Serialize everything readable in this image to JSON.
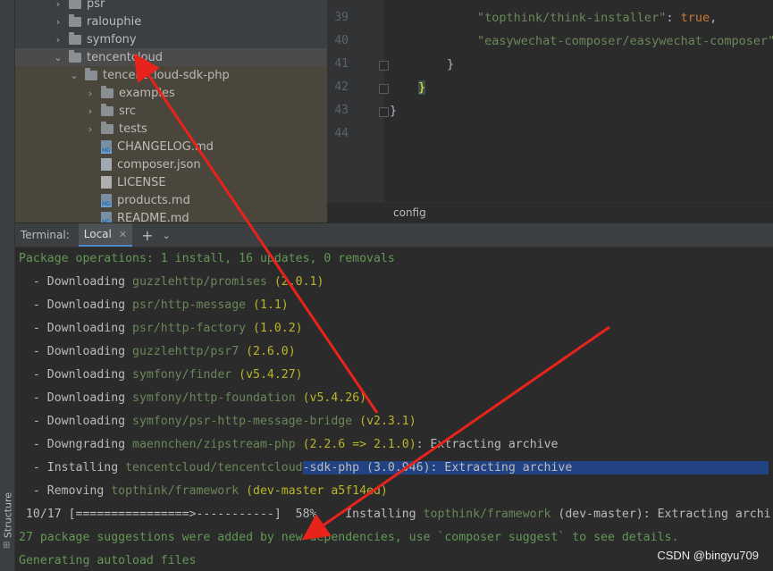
{
  "structure_label": "Structure",
  "tree": {
    "rows": [
      {
        "label": "psr",
        "expanded": false,
        "type": "folder"
      },
      {
        "label": "ralouphie",
        "expanded": false,
        "type": "folder"
      },
      {
        "label": "symfony",
        "expanded": false,
        "type": "folder"
      },
      {
        "label": "tencentcloud",
        "expanded": true,
        "type": "folder"
      },
      {
        "label": "tencentcloud-sdk-php",
        "expanded": true,
        "type": "folder"
      },
      {
        "label": "examples",
        "expanded": false,
        "type": "folder"
      },
      {
        "label": "src",
        "expanded": false,
        "type": "folder"
      },
      {
        "label": "tests",
        "expanded": false,
        "type": "folder"
      },
      {
        "label": "CHANGELOG.md",
        "type": "md"
      },
      {
        "label": "composer.json",
        "type": "json"
      },
      {
        "label": "LICENSE",
        "type": "license"
      },
      {
        "label": "products.md",
        "type": "md"
      },
      {
        "label": "README.md",
        "type": "md"
      }
    ]
  },
  "editor": {
    "line_numbers": [
      "39",
      "40",
      "41",
      "42",
      "43",
      "44"
    ],
    "line39_key": "\"topthink/think-installer\"",
    "line39_sep": ": ",
    "line39_val": "true",
    "line39_comma": ",",
    "line40_key": "\"easywechat-composer/easywechat-composer\"",
    "line40_tail": ":",
    "line41": "}",
    "line42": "}",
    "line43": "}",
    "breadcrumb": "config"
  },
  "terminal": {
    "label": "Terminal:",
    "tab": "Local",
    "tab_close": "✕",
    "plus": "+",
    "chevron": "⌄",
    "lines": {
      "l1": "Package operations: 1 install, 16 updates, 0 removals",
      "l2_pre": "  - Downloading ",
      "l2_pkg": "guzzlehttp/promises",
      "l2_ver": " (2.0.1)",
      "l3_pre": "  - Downloading ",
      "l3_pkg": "psr/http-message",
      "l3_ver": " (1.1)",
      "l4_pre": "  - Downloading ",
      "l4_pkg": "psr/http-factory",
      "l4_ver": " (1.0.2)",
      "l5_pre": "  - Downloading ",
      "l5_pkg": "guzzlehttp/psr7",
      "l5_ver": " (2.6.0)",
      "l6_pre": "  - Downloading ",
      "l6_pkg": "symfony/finder",
      "l6_ver": " (v5.4.27)",
      "l7_pre": "  - Downloading ",
      "l7_pkg": "symfony/http-foundation",
      "l7_ver": " (v5.4.26)",
      "l8_pre": "  - Downloading ",
      "l8_pkg": "symfony/psr-http-message-bridge",
      "l8_ver": " (v2.3.1)",
      "l9_pre": "  - Downgrading ",
      "l9_pkg": "maennchen/zipstream-php",
      "l9_ver": " (2.2.6 => 2.1.0)",
      "l9_tail": ": Extracting archive",
      "l10_pre": "  - Installing ",
      "l10_pkg_a": "tencentcloud/tencentcloud",
      "l10_sel": "-sdk-php (3.0.946): Extracting archive",
      "l11_pre": "  - Removing ",
      "l11_pkg": "topthink/framework",
      "l11_ver": " (dev-master a5f14ed)",
      "l12_pre": " 10/17 [================>-----------]  58%    Installing ",
      "l12_pkg": "topthink/framework",
      "l12_tail": " (dev-master): Extracting archi",
      "l13": "27 package suggestions were added by new dependencies, use `composer suggest` to see details.",
      "l14": "Generating autoload files"
    }
  },
  "watermark": "CSDN @bingyu709",
  "colors": {
    "annotation_arrow": "#e8231b",
    "selection": "#214283",
    "accent": "#4a88c7"
  }
}
